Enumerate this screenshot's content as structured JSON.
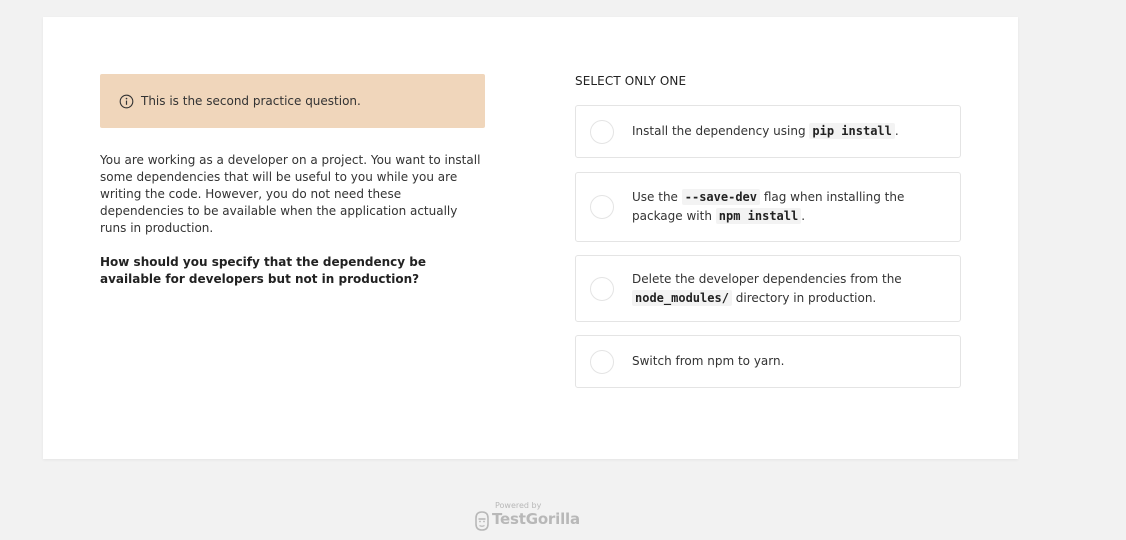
{
  "notice": {
    "icon": "info-icon",
    "text": "This is the second practice question.",
    "background": "#f0d6bb"
  },
  "question": {
    "body": "You are working as a developer on a project. You want to install some dependencies that will be useful to you while you are writing the code. However, you do not need these dependencies to be available when the application actually runs in production.",
    "ask": "How should you specify that the dependency be available for developers but not in production?"
  },
  "answers": {
    "instruction": "SELECT ONLY ONE",
    "options": [
      {
        "pre": "Install the dependency using ",
        "code": "pip install",
        "post": "."
      },
      {
        "pre": "Use the ",
        "code": "--save-dev",
        "mid": " flag when installing the package with ",
        "code2": "npm install",
        "post": "."
      },
      {
        "pre": "Delete the developer dependencies from the ",
        "code": "node_modules/",
        "post": " directory in production."
      },
      {
        "pre": "Switch from npm to yarn."
      }
    ]
  },
  "footer": {
    "powered_by": "Powered by",
    "brand": "TestGorilla",
    "logo_icon": "gorilla-logo-icon"
  }
}
